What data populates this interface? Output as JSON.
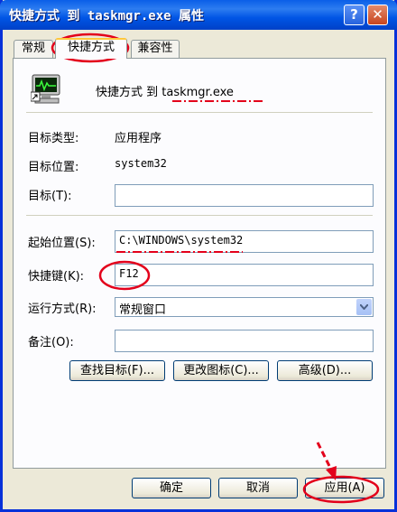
{
  "window": {
    "title": "快捷方式 到 taskmgr.exe 属性",
    "help_glyph": "?",
    "close_glyph": "✕"
  },
  "tabs": [
    {
      "label": "常规"
    },
    {
      "label": "快捷方式"
    },
    {
      "label": "兼容性"
    }
  ],
  "header": {
    "name": "快捷方式 到 taskmgr.exe"
  },
  "info": {
    "target_type_label": "目标类型:",
    "target_type_value": "应用程序",
    "target_location_label": "目标位置:",
    "target_location_value": "system32",
    "target_label": "目标(T):",
    "target_value": ""
  },
  "form": {
    "start_in_label": "起始位置(S):",
    "start_in_value": "C:\\WINDOWS\\system32",
    "shortcut_key_label": "快捷键(K):",
    "shortcut_key_value": "F12",
    "run_label": "运行方式(R):",
    "run_value": "常规窗口",
    "comment_label": "备注(O):",
    "comment_value": ""
  },
  "actions": {
    "find_target": "查找目标(F)...",
    "change_icon": "更改图标(C)...",
    "advanced": "高级(D)..."
  },
  "footer": {
    "ok": "确定",
    "cancel": "取消",
    "apply": "应用(A)"
  },
  "colors": {
    "annotation": "#e3001b",
    "title_bar": "#0a5fe8"
  }
}
